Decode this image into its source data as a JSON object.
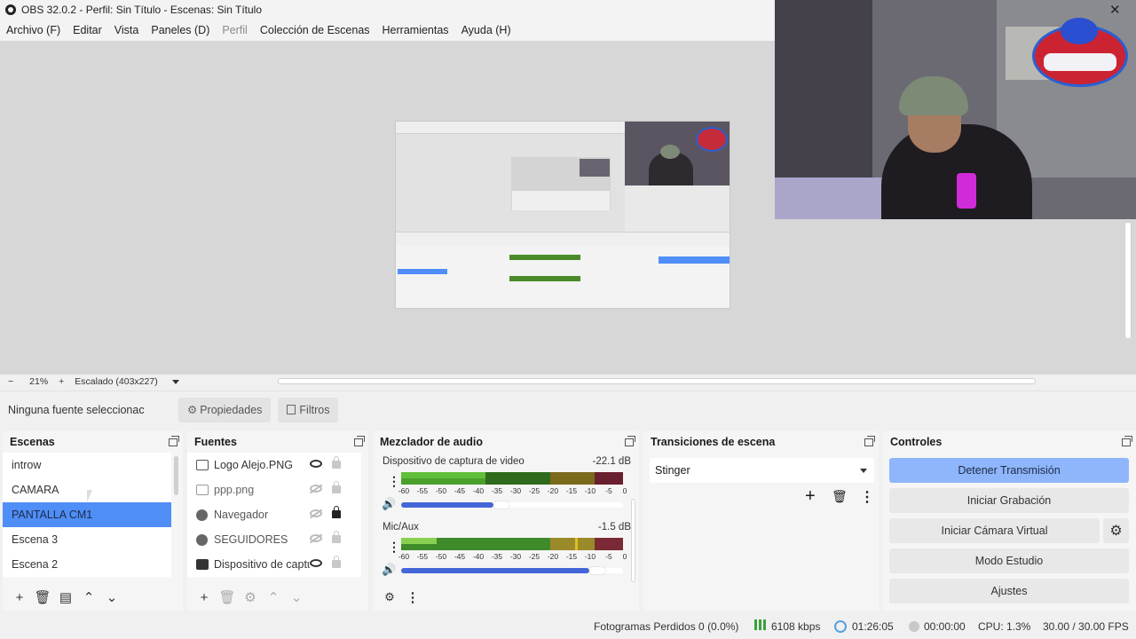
{
  "window": {
    "title": "OBS 32.0.2 - Perfil: Sin Título - Escenas: Sin Título",
    "close_glyph": "✕"
  },
  "menu": [
    "Archivo (F)",
    "Editar",
    "Vista",
    "Paneles (D)",
    "Perfil",
    "Colección de Escenas",
    "Herramientas",
    "Ayuda (H)"
  ],
  "zoom": {
    "minus": "−",
    "value": "21%",
    "plus": "+",
    "scaling": "Escalado (403x227)"
  },
  "props": {
    "no_source": "Ninguna fuente seleccionac",
    "properties_label": "Propiedades",
    "filters_label": "Filtros"
  },
  "scenes": {
    "title": "Escenas",
    "items": [
      "introw",
      "CAMARA",
      "PANTALLA CM1",
      "Escena 3",
      "Escena 2"
    ],
    "selected": "PANTALLA CM1"
  },
  "sources": {
    "title": "Fuentes",
    "items": [
      {
        "name": "Logo Alejo.PNG",
        "icon": "image-icon",
        "visible": true,
        "locked": false
      },
      {
        "name": "ppp.png",
        "icon": "image-icon",
        "visible": false,
        "locked": false
      },
      {
        "name": "Navegador",
        "icon": "browser-icon",
        "visible": false,
        "locked": true
      },
      {
        "name": "SEGUIDORES",
        "icon": "browser-icon",
        "visible": false,
        "locked": false
      },
      {
        "name": "Dispositivo de captu",
        "icon": "camera-icon",
        "visible": true,
        "locked": false
      }
    ]
  },
  "mixer": {
    "title": "Mezclador de audio",
    "channels": [
      {
        "name": "Dispositivo de captura de video",
        "level": "-22.1 dB",
        "meter_fill": 0.38,
        "volume": 0.46
      },
      {
        "name": "Mic/Aux",
        "level": "-1.5 dB",
        "meter_fill": 0.8,
        "volume": 0.84
      }
    ],
    "ticks": [
      "-60",
      "-55",
      "-50",
      "-45",
      "-40",
      "-35",
      "-30",
      "-25",
      "-20",
      "-15",
      "-10",
      "-5",
      "0"
    ]
  },
  "transitions": {
    "title": "Transiciones de escena",
    "selected": "Stinger"
  },
  "controls": {
    "title": "Controles",
    "stop_stream": "Detener Transmisión",
    "start_record": "Iniciar Grabación",
    "virtual_cam": "Iniciar Cámara Virtual",
    "studio_mode": "Modo Estudio",
    "settings": "Ajustes"
  },
  "status": {
    "dropped_frames": "Fotogramas Perdidos 0 (0.0%)",
    "bitrate": "6108 kbps",
    "stream_time": "01:26:05",
    "record_time": "00:00:00",
    "cpu": "CPU: 1.3%",
    "fps": "30.00 / 30.00 FPS"
  },
  "colors": {
    "accent": "#4f8ef7",
    "meter_green": "#4a8a2a",
    "meter_yellow": "#9a8a2a",
    "meter_red": "#7a2a35",
    "volume_blue": "#4466d8"
  }
}
